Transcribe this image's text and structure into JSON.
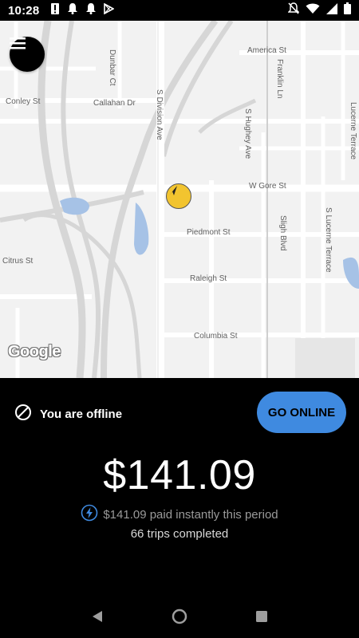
{
  "status_bar": {
    "time": "10:28",
    "left_icons": [
      "alert-icon",
      "notification-bell-icon",
      "notification-bell-icon",
      "play-store-icon"
    ],
    "right_icons": [
      "notifications-off-icon",
      "wifi-icon",
      "signal-icon",
      "battery-icon"
    ]
  },
  "map": {
    "streets": {
      "america": "America St",
      "franklin": "Franklin Ln",
      "dunbar": "Dunbar Ct",
      "conley": "Conley St",
      "callahan": "Callahan Dr",
      "division": "S Division Ave",
      "hughey": "S Hughey Ave",
      "lucerne_terrace": "Lucerne Terrace",
      "gore": "W Gore St",
      "piedmont": "Piedmont St",
      "sligh": "Sligh Blvd",
      "s_lucerne": "S Lucerne Terrace",
      "citrus": "Citrus St",
      "raleigh": "Raleigh St",
      "columbia": "Columbia St"
    },
    "logo": "Google",
    "marker_icon": "navigation-arrow-icon",
    "marker_color": "#f2c42f"
  },
  "panel": {
    "status_text": "You are offline",
    "status_icon": "offline-icon",
    "go_online_label": "GO ONLINE",
    "accent_color": "#3f8ae0",
    "earnings": "$141.09",
    "instant_text": "$141.09 paid instantly this period",
    "instant_icon": "lightning-icon",
    "trips_text": "66 trips completed"
  },
  "nav": {
    "back_icon": "back-icon",
    "home_icon": "home-icon",
    "recents_icon": "recents-icon"
  }
}
